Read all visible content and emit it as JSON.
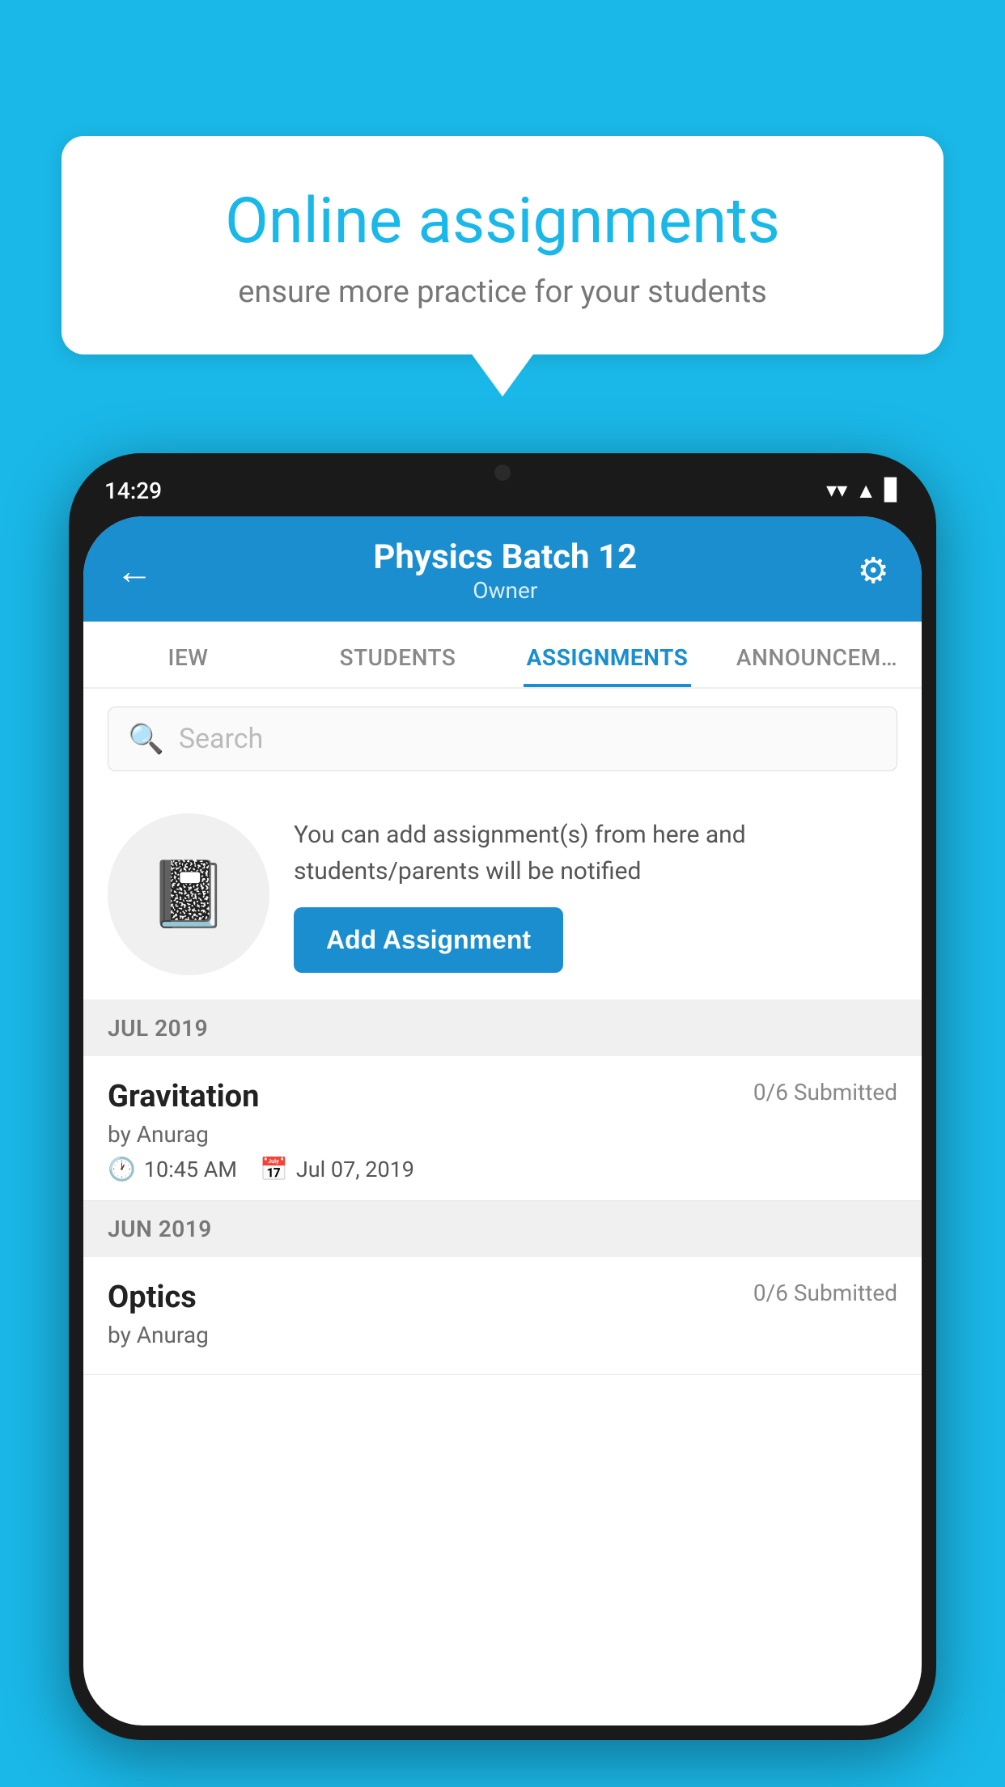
{
  "background_color": "#1ab8e8",
  "promo": {
    "title": "Online assignments",
    "subtitle": "ensure more practice for your students"
  },
  "phone": {
    "status_bar": {
      "time": "14:29",
      "wifi": "▲",
      "signal": "▲",
      "battery": "▊"
    },
    "header": {
      "title": "Physics Batch 12",
      "subtitle": "Owner",
      "back_label": "←",
      "settings_label": "⚙"
    },
    "tabs": [
      {
        "id": "iew",
        "label": "IEW",
        "active": false
      },
      {
        "id": "students",
        "label": "STUDENTS",
        "active": false
      },
      {
        "id": "assignments",
        "label": "ASSIGNMENTS",
        "active": true
      },
      {
        "id": "announcements",
        "label": "ANNOUNCEM…",
        "active": false
      }
    ],
    "search": {
      "placeholder": "Search"
    },
    "assignment_promo": {
      "description": "You can add assignment(s) from here and students/parents will be notified",
      "button_label": "Add Assignment"
    },
    "sections": [
      {
        "label": "JUL 2019",
        "items": [
          {
            "name": "Gravitation",
            "submitted": "0/6 Submitted",
            "by": "by Anurag",
            "time": "10:45 AM",
            "date": "Jul 07, 2019"
          }
        ]
      },
      {
        "label": "JUN 2019",
        "items": [
          {
            "name": "Optics",
            "submitted": "0/6 Submitted",
            "by": "by Anurag",
            "time": "",
            "date": ""
          }
        ]
      }
    ]
  }
}
